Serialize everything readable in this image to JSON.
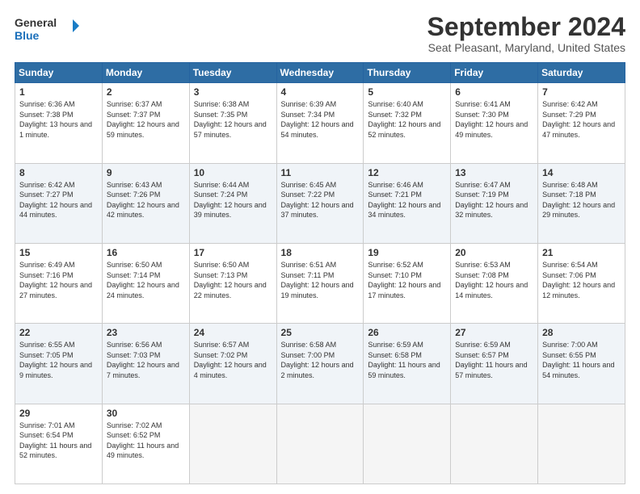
{
  "header": {
    "logo_line1": "General",
    "logo_line2": "Blue",
    "main_title": "September 2024",
    "subtitle": "Seat Pleasant, Maryland, United States"
  },
  "days": [
    "Sunday",
    "Monday",
    "Tuesday",
    "Wednesday",
    "Thursday",
    "Friday",
    "Saturday"
  ],
  "weeks": [
    [
      {
        "day": "1",
        "sunrise": "6:36 AM",
        "sunset": "7:38 PM",
        "daylight": "13 hours and 1 minute."
      },
      {
        "day": "2",
        "sunrise": "6:37 AM",
        "sunset": "7:37 PM",
        "daylight": "12 hours and 59 minutes."
      },
      {
        "day": "3",
        "sunrise": "6:38 AM",
        "sunset": "7:35 PM",
        "daylight": "12 hours and 57 minutes."
      },
      {
        "day": "4",
        "sunrise": "6:39 AM",
        "sunset": "7:34 PM",
        "daylight": "12 hours and 54 minutes."
      },
      {
        "day": "5",
        "sunrise": "6:40 AM",
        "sunset": "7:32 PM",
        "daylight": "12 hours and 52 minutes."
      },
      {
        "day": "6",
        "sunrise": "6:41 AM",
        "sunset": "7:30 PM",
        "daylight": "12 hours and 49 minutes."
      },
      {
        "day": "7",
        "sunrise": "6:42 AM",
        "sunset": "7:29 PM",
        "daylight": "12 hours and 47 minutes."
      }
    ],
    [
      {
        "day": "8",
        "sunrise": "6:42 AM",
        "sunset": "7:27 PM",
        "daylight": "12 hours and 44 minutes."
      },
      {
        "day": "9",
        "sunrise": "6:43 AM",
        "sunset": "7:26 PM",
        "daylight": "12 hours and 42 minutes."
      },
      {
        "day": "10",
        "sunrise": "6:44 AM",
        "sunset": "7:24 PM",
        "daylight": "12 hours and 39 minutes."
      },
      {
        "day": "11",
        "sunrise": "6:45 AM",
        "sunset": "7:22 PM",
        "daylight": "12 hours and 37 minutes."
      },
      {
        "day": "12",
        "sunrise": "6:46 AM",
        "sunset": "7:21 PM",
        "daylight": "12 hours and 34 minutes."
      },
      {
        "day": "13",
        "sunrise": "6:47 AM",
        "sunset": "7:19 PM",
        "daylight": "12 hours and 32 minutes."
      },
      {
        "day": "14",
        "sunrise": "6:48 AM",
        "sunset": "7:18 PM",
        "daylight": "12 hours and 29 minutes."
      }
    ],
    [
      {
        "day": "15",
        "sunrise": "6:49 AM",
        "sunset": "7:16 PM",
        "daylight": "12 hours and 27 minutes."
      },
      {
        "day": "16",
        "sunrise": "6:50 AM",
        "sunset": "7:14 PM",
        "daylight": "12 hours and 24 minutes."
      },
      {
        "day": "17",
        "sunrise": "6:50 AM",
        "sunset": "7:13 PM",
        "daylight": "12 hours and 22 minutes."
      },
      {
        "day": "18",
        "sunrise": "6:51 AM",
        "sunset": "7:11 PM",
        "daylight": "12 hours and 19 minutes."
      },
      {
        "day": "19",
        "sunrise": "6:52 AM",
        "sunset": "7:10 PM",
        "daylight": "12 hours and 17 minutes."
      },
      {
        "day": "20",
        "sunrise": "6:53 AM",
        "sunset": "7:08 PM",
        "daylight": "12 hours and 14 minutes."
      },
      {
        "day": "21",
        "sunrise": "6:54 AM",
        "sunset": "7:06 PM",
        "daylight": "12 hours and 12 minutes."
      }
    ],
    [
      {
        "day": "22",
        "sunrise": "6:55 AM",
        "sunset": "7:05 PM",
        "daylight": "12 hours and 9 minutes."
      },
      {
        "day": "23",
        "sunrise": "6:56 AM",
        "sunset": "7:03 PM",
        "daylight": "12 hours and 7 minutes."
      },
      {
        "day": "24",
        "sunrise": "6:57 AM",
        "sunset": "7:02 PM",
        "daylight": "12 hours and 4 minutes."
      },
      {
        "day": "25",
        "sunrise": "6:58 AM",
        "sunset": "7:00 PM",
        "daylight": "12 hours and 2 minutes."
      },
      {
        "day": "26",
        "sunrise": "6:59 AM",
        "sunset": "6:58 PM",
        "daylight": "11 hours and 59 minutes."
      },
      {
        "day": "27",
        "sunrise": "6:59 AM",
        "sunset": "6:57 PM",
        "daylight": "11 hours and 57 minutes."
      },
      {
        "day": "28",
        "sunrise": "7:00 AM",
        "sunset": "6:55 PM",
        "daylight": "11 hours and 54 minutes."
      }
    ],
    [
      {
        "day": "29",
        "sunrise": "7:01 AM",
        "sunset": "6:54 PM",
        "daylight": "11 hours and 52 minutes."
      },
      {
        "day": "30",
        "sunrise": "7:02 AM",
        "sunset": "6:52 PM",
        "daylight": "11 hours and 49 minutes."
      },
      null,
      null,
      null,
      null,
      null
    ]
  ]
}
